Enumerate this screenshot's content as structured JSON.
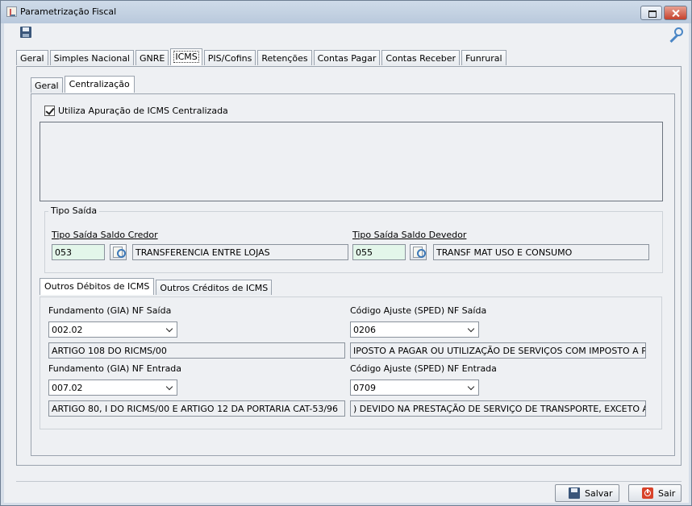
{
  "window": {
    "title": "Parametrização Fiscal"
  },
  "main_tabs": [
    "Geral",
    "Simples Nacional",
    "GNRE",
    "ICMS",
    "PIS/Cofins",
    "Retenções",
    "Contas Pagar",
    "Contas Receber",
    "Funrural"
  ],
  "active_main_tab": "ICMS",
  "sub_tabs": [
    "Geral",
    "Centralização"
  ],
  "active_sub_tab": "Centralização",
  "centralizacao": {
    "checkbox_label": "Utiliza Apuração de ICMS Centralizada",
    "checkbox_checked": true
  },
  "tipo_saida": {
    "group_title": "Tipo Saída",
    "credor": {
      "label": "Tipo Saída Saldo Credor",
      "code": "053",
      "description": "TRANSFERENCIA ENTRE LOJAS"
    },
    "devedor": {
      "label": "Tipo Saída Saldo Devedor",
      "code": "055",
      "description": "TRANSF MAT USO E CONSUMO"
    }
  },
  "bottom_tabs": [
    "Outros Débitos de ICMS",
    "Outros Créditos de ICMS"
  ],
  "active_bottom_tab": "Outros Débitos de ICMS",
  "outros_debitos": {
    "fund_saida_label": "Fundamento (GIA) NF Saída",
    "fund_saida_value": "002.02",
    "fund_saida_desc": "ARTIGO 108 DO RICMS/00",
    "cod_saida_label": "Código Ajuste (SPED) NF Saída",
    "cod_saida_value": "0206",
    "cod_saida_desc": "IPOSTO A PAGAR OU UTILIZAÇÃO DE SERVIÇOS COM IMPOSTO A PAGAR.",
    "fund_entrada_label": "Fundamento (GIA) NF Entrada",
    "fund_entrada_value": "007.02",
    "fund_entrada_desc": "ARTIGO 80, I DO RICMS/00 E ARTIGO 12 DA PORTARIA CAT-53/96",
    "cod_entrada_label": "Código Ajuste (SPED) NF Entrada",
    "cod_entrada_value": "0709",
    "cod_entrada_desc": ") DEVIDO NA PRESTAÇÃO DE SERVIÇO DE TRANSPORTE, EXCETO AÉREO."
  },
  "footer": {
    "save_label": "Salvar",
    "exit_label": "Sair"
  },
  "icons": {
    "title": "java-cup-icon",
    "toolbar_save": "floppy-disk-icon",
    "toolbar_right": "key-icon",
    "lookup": "lookup-icon",
    "save": "floppy-disk-icon",
    "exit": "power-icon"
  }
}
